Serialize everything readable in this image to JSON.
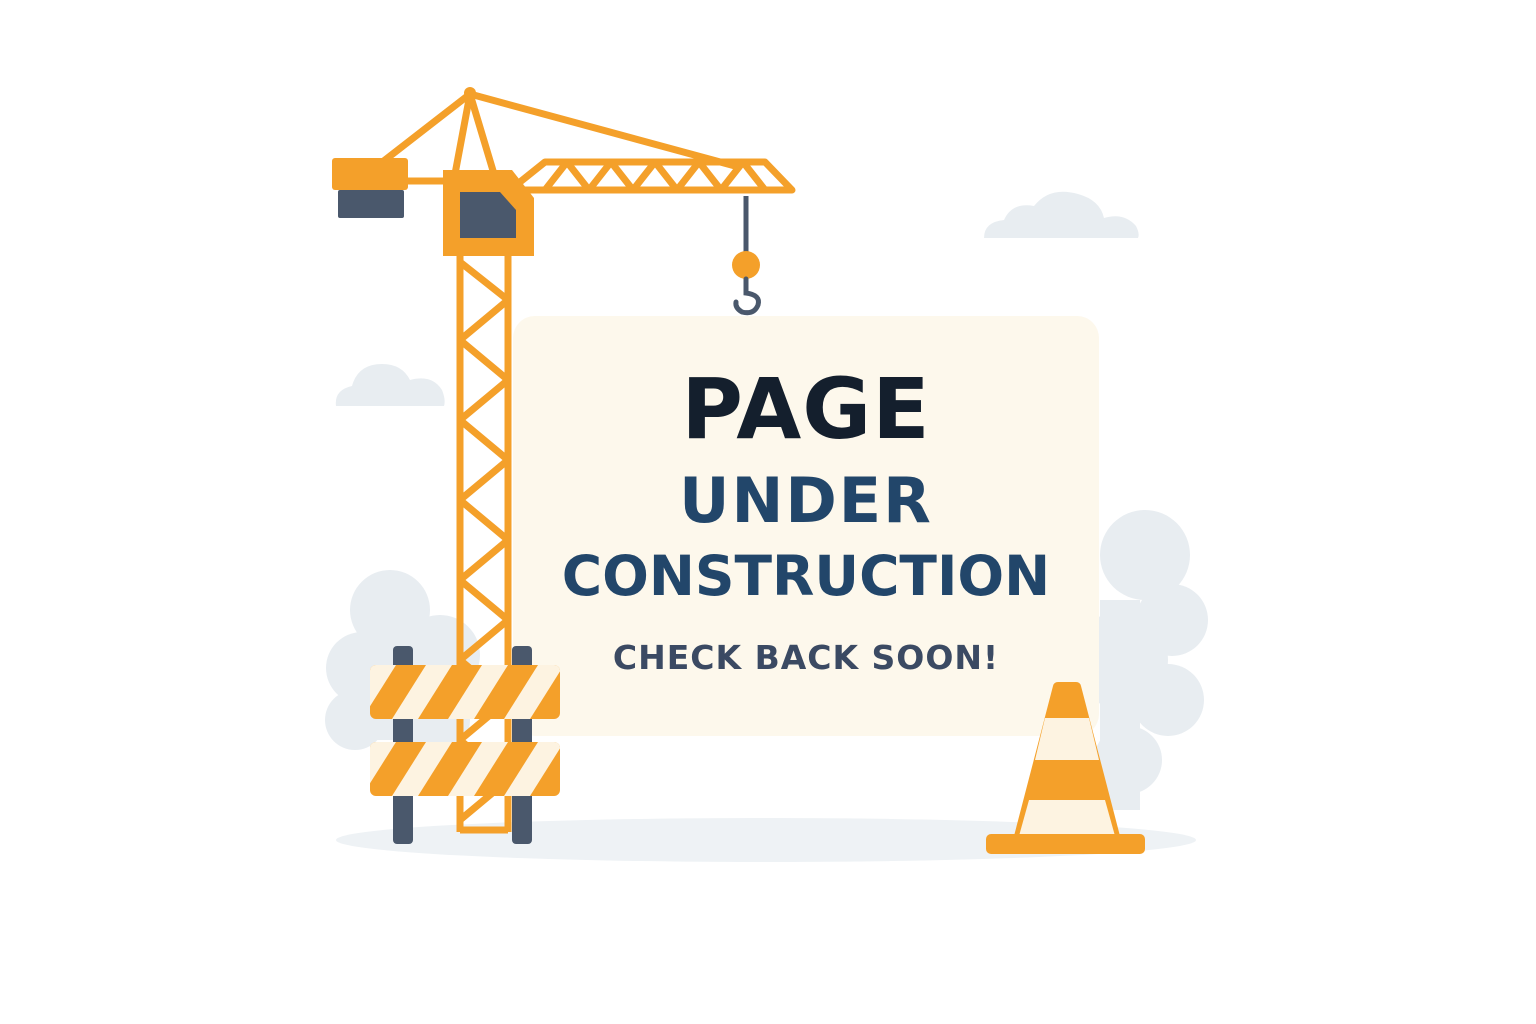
{
  "sign": {
    "title": "PAGE",
    "subtitle_1": "UNDER",
    "subtitle_2": "CONSTRUCTION",
    "tagline": "CHECK BACK SOON!"
  },
  "illustration": {
    "elements": [
      "crane-icon",
      "crane-hook-icon",
      "barricade-icon",
      "traffic-cone-icon",
      "cloud-icon",
      "bush-icon"
    ]
  },
  "colors": {
    "accent_orange": "#f4a02a",
    "crane_dark": "#4a586c",
    "sign_background": "#fdf8ec",
    "title_dark": "#141f2d",
    "heading_blue": "#22466a",
    "tagline_slate": "#3b4a63",
    "cloud_grey": "#e8edf1",
    "cone_stripe": "#fdf3e1"
  }
}
